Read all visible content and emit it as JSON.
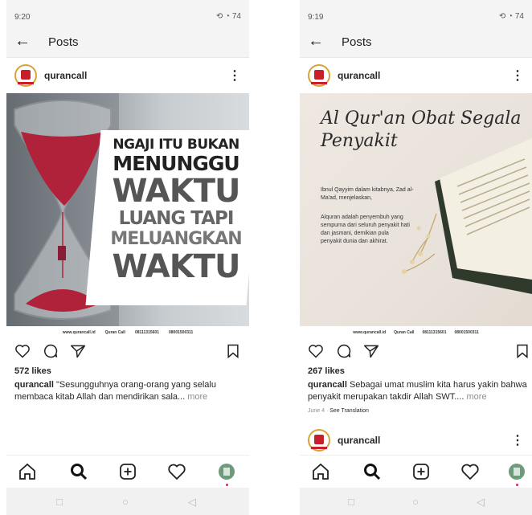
{
  "left": {
    "status": {
      "time": "9:20",
      "icons": "⟲ ◔ 74"
    },
    "appbar": {
      "title": "Posts"
    },
    "post": {
      "username": "qurancall",
      "image_headline": [
        "NGAJI ITU BUKAN",
        "MENUNGGU",
        "WAKTU",
        "LUANG TAPI",
        "MELUANGKAN",
        "WAKTU"
      ],
      "footer_items": [
        "www.qurancall.id",
        "Quran Call",
        "08111315601",
        "08001500311"
      ],
      "likes": "572 likes",
      "caption_user": "qurancall",
      "caption_text": " \"Sesungguhnya orang-orang yang selalu membaca kitab Allah dan mendirikan sala...",
      "caption_more": " more"
    }
  },
  "right": {
    "status": {
      "time": "9:19",
      "icons": "⟲ ◔ 74"
    },
    "appbar": {
      "title": "Posts"
    },
    "post": {
      "username": "qurancall",
      "image_title": [
        "Al Qur'an Obat Segala",
        "Penyakit"
      ],
      "image_text1": "Ibnul Qayyim dalam kitabnya, Zad al-Ma'ad, menjelaskan,",
      "image_text2": "Alquran adalah penyembuh yang sempurna dari seluruh penyakit hati dan jasmani, demikian pula penyakit dunia dan akhirat.",
      "footer_items": [
        "www.qurancall.id",
        "Quran Call",
        "08111315601",
        "08001500311"
      ],
      "likes": "267 likes",
      "caption_user": "qurancall",
      "caption_text": " Sebagai umat muslim kita harus yakin bahwa penyakit merupakan takdir Allah SWT....",
      "caption_more": " more",
      "date": "June 4 · ",
      "see_translation": "See Translation"
    },
    "next_post": {
      "username": "qurancall"
    }
  }
}
